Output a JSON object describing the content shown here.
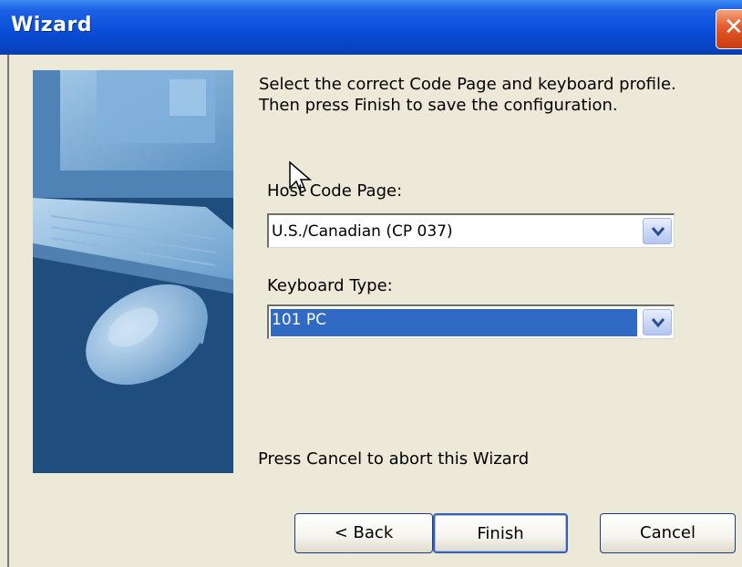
{
  "window": {
    "title": "Wizard"
  },
  "prompt": {
    "line1": "Select the correct Code Page and keyboard profile.",
    "line2": "Then press Finish to save the configuration."
  },
  "host_code_page": {
    "label": "Host Code Page:",
    "value": "U.S./Canadian (CP 037)"
  },
  "keyboard_type": {
    "label": "Keyboard Type:",
    "value": "101 PC"
  },
  "cancel_hint": "Press Cancel to abort this Wizard",
  "buttons": {
    "back": "< Back",
    "finish": "Finish",
    "cancel": "Cancel"
  },
  "icons": {
    "close": "close-icon",
    "dropdown": "chevron-down-icon",
    "cursor": "mouse-cursor-icon"
  },
  "colors": {
    "titlebar": "#0a4fd9",
    "selection": "#316ac5",
    "dialog_bg": "#ece9d8",
    "art_bg": "#1f4e7e"
  }
}
